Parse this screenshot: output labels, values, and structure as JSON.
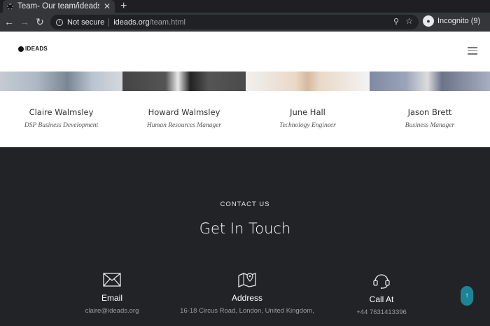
{
  "browser": {
    "tab_title": "Team- Our team/ideads.o",
    "tab_close": "✕",
    "new_tab": "+",
    "security_label": "Not secure",
    "url_host": "ideads.org",
    "url_path": "/team.html",
    "profile_label": "Incognito (9)"
  },
  "site": {
    "logo_text": "IDEADS"
  },
  "team": {
    "members": [
      {
        "name": "Claire Walmsley",
        "role": "DSP Business Development"
      },
      {
        "name": "Howard Walmsley",
        "role": "Human Resources Manager"
      },
      {
        "name": "June Hall",
        "role": "Technology Engineer"
      },
      {
        "name": "Jason Brett",
        "role": "Business Manager"
      }
    ]
  },
  "contact": {
    "kicker": "CONTACT US",
    "heading": "Get In Touch",
    "items": [
      {
        "title": "Email",
        "value": "claire@ideads.org",
        "icon": "envelope-icon"
      },
      {
        "title": "Address",
        "value": "16-18 Circus Road, London, United Kingdom,",
        "icon": "map-pin-icon"
      },
      {
        "title": "Call At",
        "value": "+44 7631413396",
        "icon": "headset-icon"
      }
    ]
  },
  "colors": {
    "contact_bg": "#222326",
    "scroll_button": "#1b8595"
  }
}
